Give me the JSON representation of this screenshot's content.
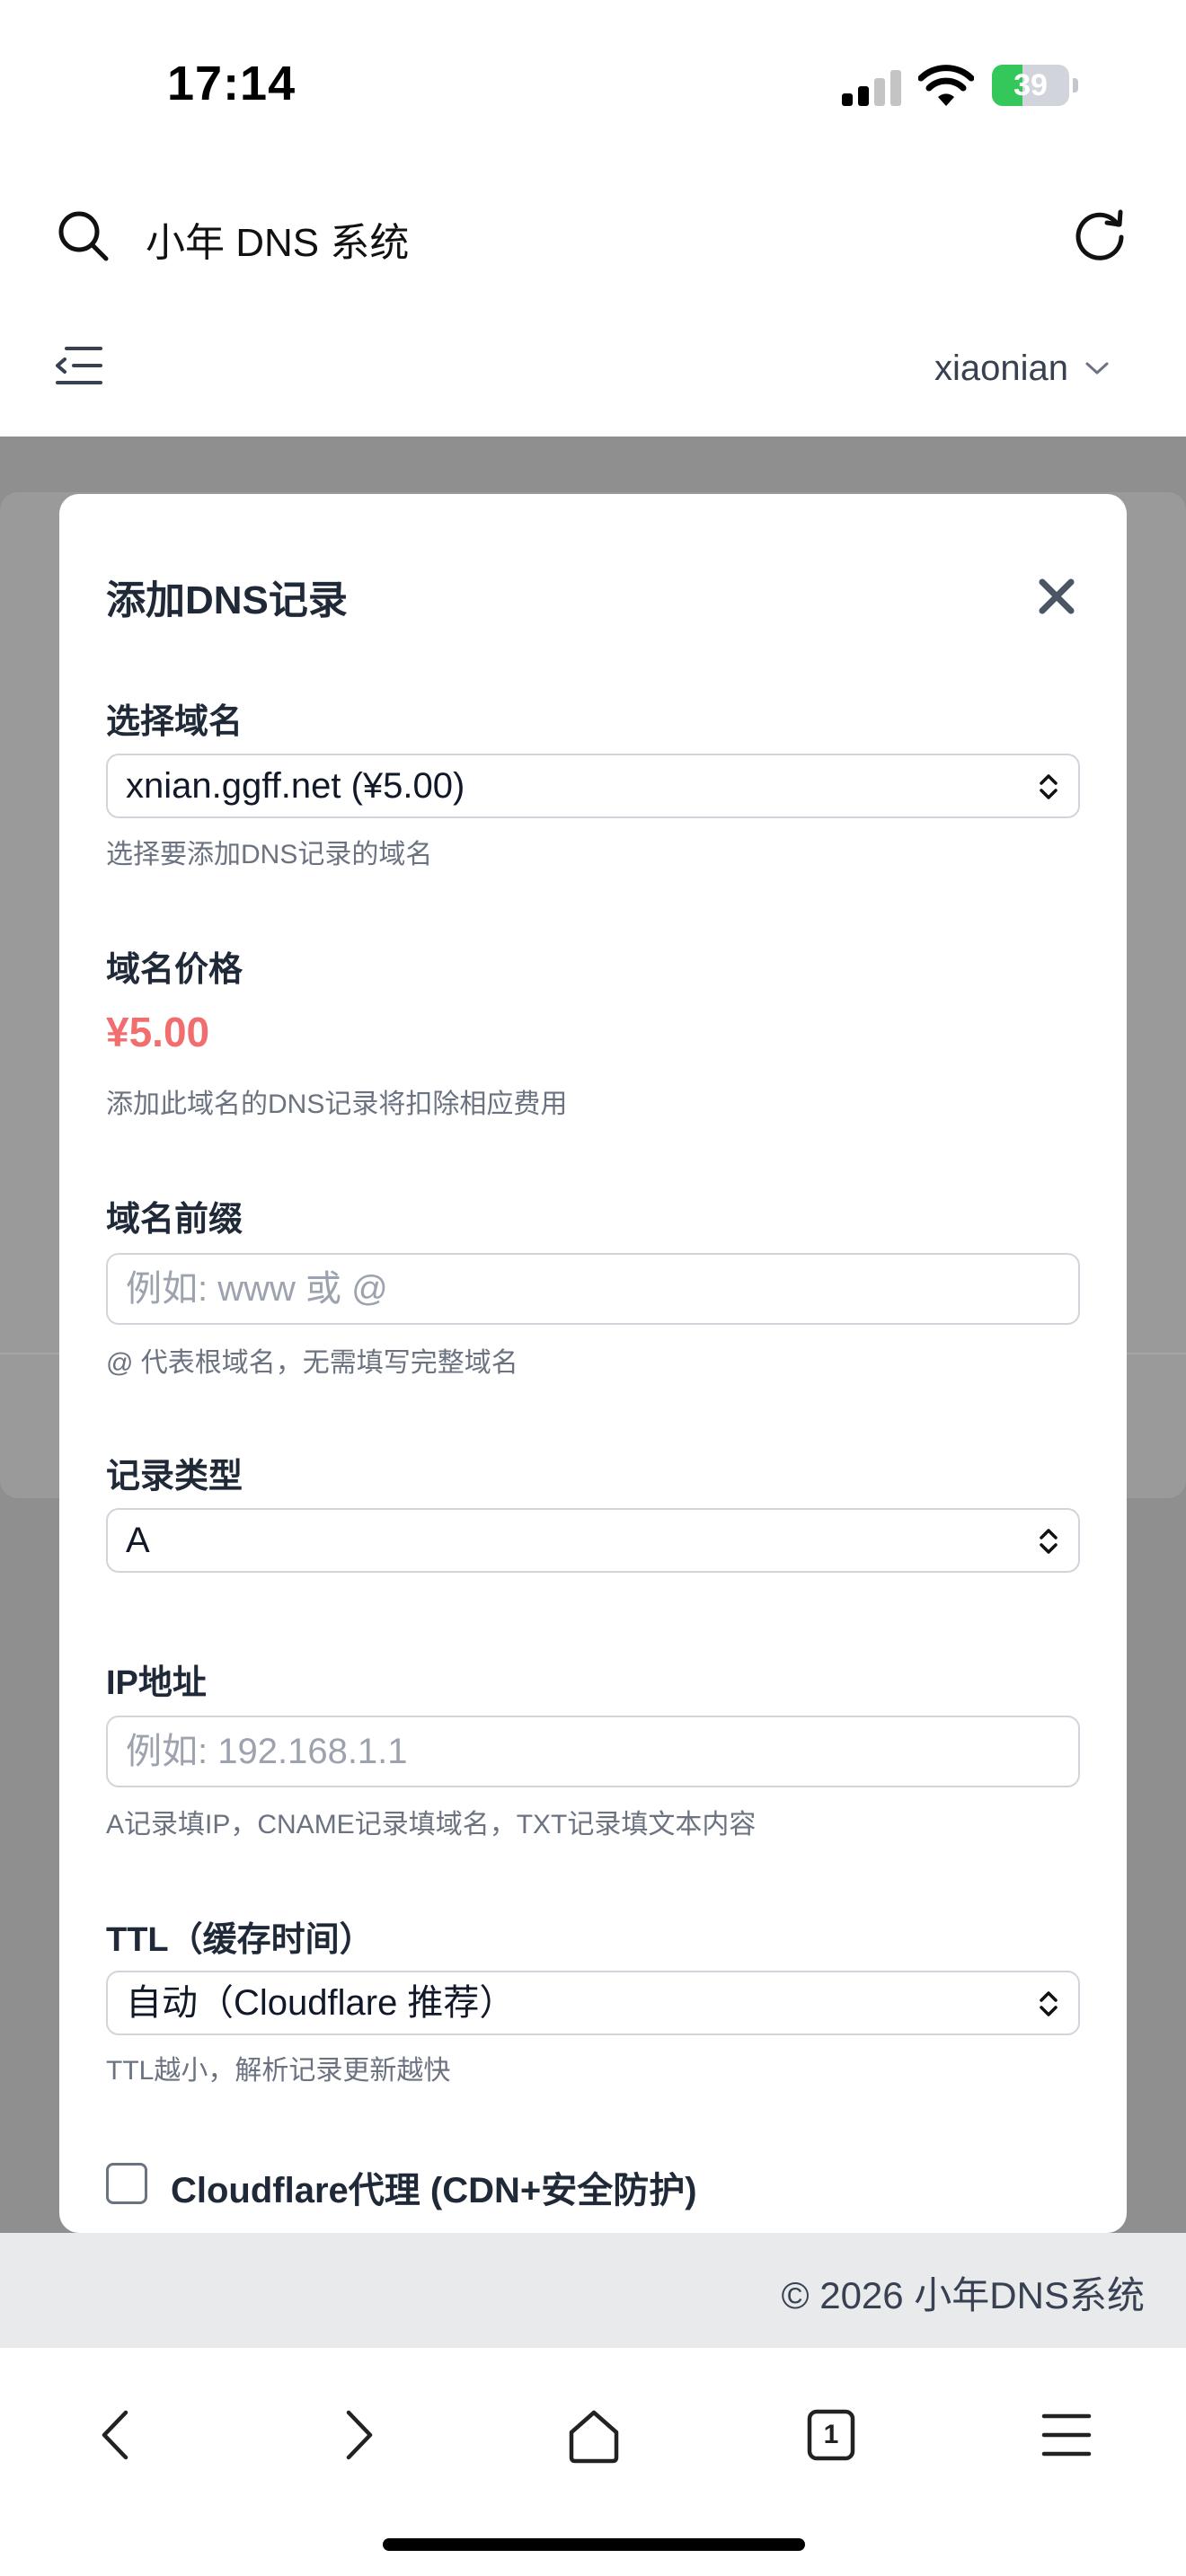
{
  "status_bar": {
    "time": "17:14",
    "battery_level": "39",
    "battery_fraction": 0.39
  },
  "address_bar": {
    "title": "小年 DNS 系统"
  },
  "header": {
    "username": "xiaonian"
  },
  "modal": {
    "title": "添加DNS记录",
    "domain": {
      "label": "选择域名",
      "value": "xnian.ggff.net (¥5.00)",
      "helper": "选择要添加DNS记录的域名"
    },
    "price": {
      "label": "域名价格",
      "value": "¥5.00",
      "helper": "添加此域名的DNS记录将扣除相应费用"
    },
    "prefix": {
      "label": "域名前缀",
      "placeholder": "例如: www 或 @",
      "helper": "@ 代表根域名，无需填写完整域名"
    },
    "record_type": {
      "label": "记录类型",
      "value": "A"
    },
    "ip": {
      "label": "IP地址",
      "placeholder": "例如: 192.168.1.1",
      "helper": "A记录填IP，CNAME记录填域名，TXT记录填文本内容"
    },
    "ttl": {
      "label": "TTL（缓存时间）",
      "value": "自动（Cloudflare 推荐）",
      "helper": "TTL越小，解析记录更新越快"
    },
    "proxy": {
      "label": "Cloudflare代理 (CDN+安全防护)",
      "checked": false
    }
  },
  "footer": {
    "text": "© 2026 小年DNS系统"
  },
  "toolbar": {
    "tabs_count": "1"
  },
  "colors": {
    "price": "#f26d6d",
    "battery": "#34c759",
    "backdrop": "#8f8f8f"
  }
}
